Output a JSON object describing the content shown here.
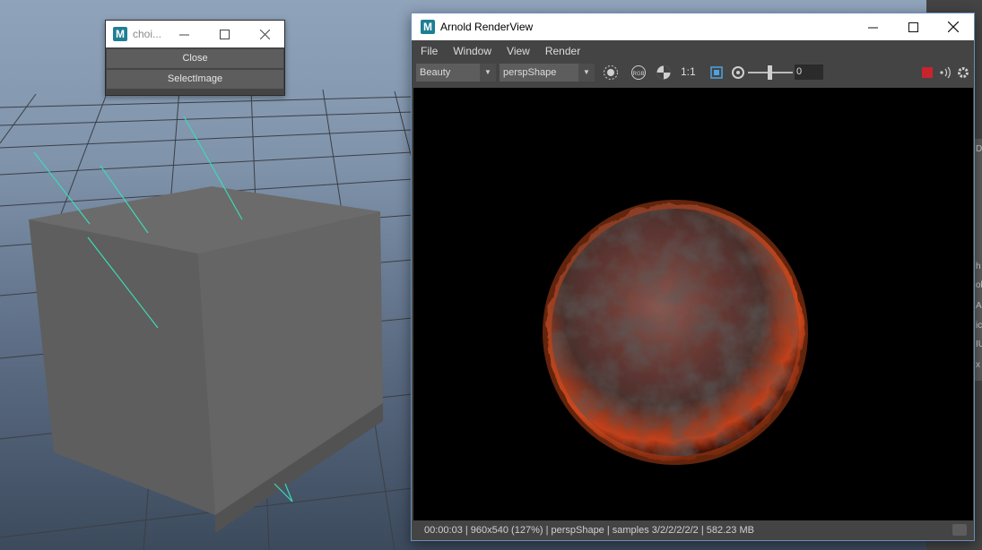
{
  "choice_window": {
    "title": "choi...",
    "buttons": {
      "close_label": "Close",
      "select_image_label": "SelectImage"
    }
  },
  "arnold": {
    "title": "Arnold RenderView",
    "menu": [
      "File",
      "Window",
      "View",
      "Render"
    ],
    "toolbar": {
      "aov_select": "Beauty",
      "camera_select": "perspShape",
      "ratio_label": "1:1",
      "exposure_value": "0"
    },
    "status": {
      "text": "00:00:03 | 960x540 (127%) | perspShape  | samples 3/2/2/2/2/2 | 582.23 MB"
    },
    "colors": {
      "stop": "#c8242e",
      "window_border": "#6a8fb8"
    }
  },
  "side_panel_chars": [
    "Di",
    "h",
    "ob",
    "Ar",
    "ic",
    "IU",
    "x"
  ],
  "icons": {
    "maya_logo": "M",
    "minimize": "minimize-icon",
    "maximize": "maximize-icon",
    "close": "close-icon"
  }
}
